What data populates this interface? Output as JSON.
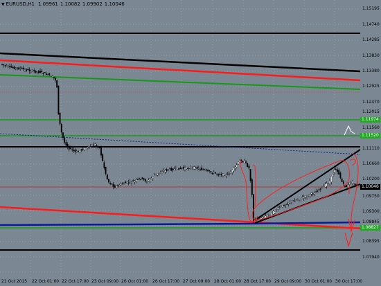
{
  "chart": {
    "symbol": "EURUSD,H1",
    "quotes": [
      "1.09961",
      "1.10082",
      "1.09902",
      "1.10046"
    ]
  },
  "price_scale": {
    "labels": [
      "1.15195",
      "1.14740",
      "1.14285",
      "1.13830",
      "1.13380",
      "1.12925",
      "1.12470",
      "1.12015",
      "1.11560",
      "1.11110",
      "1.10660",
      "1.10200",
      "1.09750",
      "1.09300",
      "1.08845",
      "1.08395",
      "1.07940"
    ],
    "badges": [
      "1.11974",
      "1.11520",
      "1.10046",
      "1.08827"
    ]
  },
  "time_scale": {
    "labels": [
      "21 Oct 2015",
      "22 Oct 01:00",
      "22 Oct 17:00",
      "23 Oct 09:00",
      "26 Oct 01:00",
      "26 Oct 17:00",
      "27 Oct 09:00",
      "28 Oct 01:00",
      "28 Oct 17:00",
      "29 Oct 09:00",
      "30 Oct 01:00",
      "30 Oct 17:00"
    ]
  },
  "colors": {
    "background": "#7b8893",
    "grid": "#aab3ba",
    "black_line": "#000000",
    "red_line": "#ff1a1a",
    "green_line": "#159a15",
    "blue_line": "#0a1a9a",
    "candle_bull": "#ffffff",
    "candle_bear": "#000000",
    "drawing": "#ff2020",
    "badge_green": "#22aa22",
    "badge_black": "#000000"
  }
}
